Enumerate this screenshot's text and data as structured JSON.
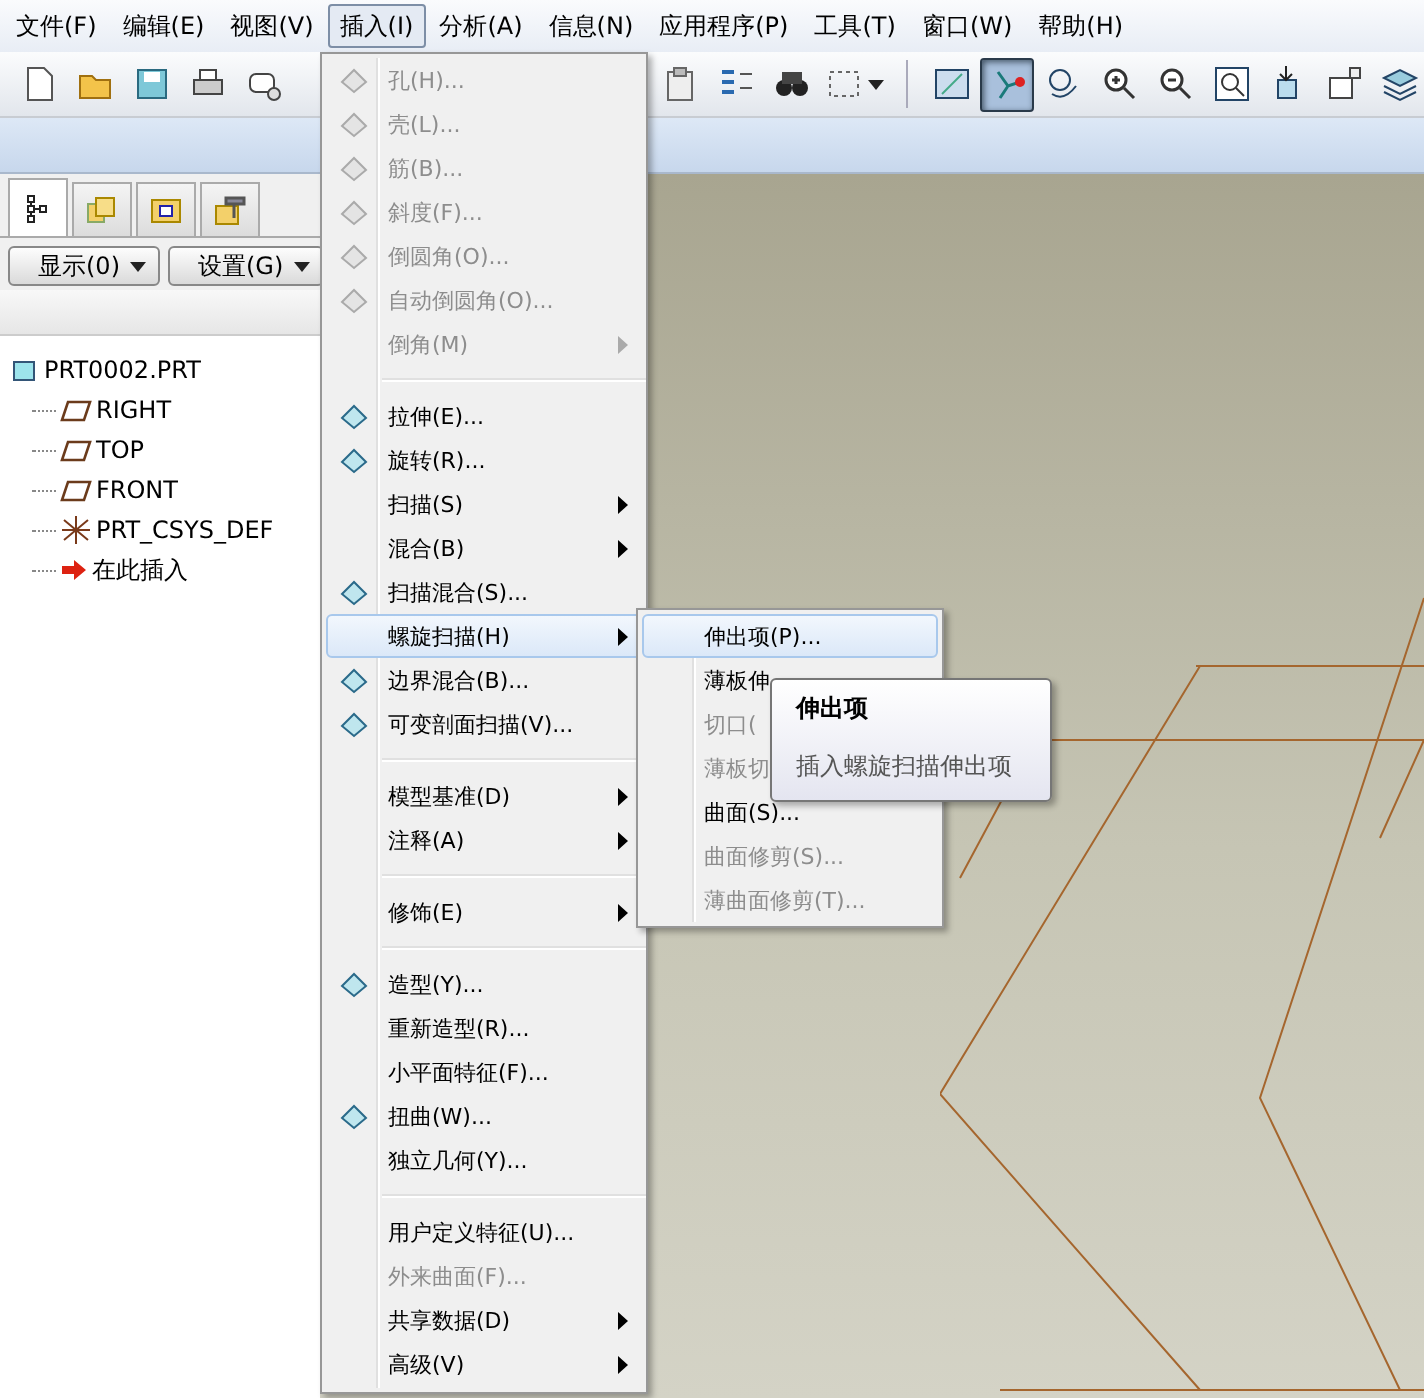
{
  "menubar": [
    {
      "label": "文件(F)",
      "selected": false
    },
    {
      "label": "编辑(E)",
      "selected": false
    },
    {
      "label": "视图(V)",
      "selected": false
    },
    {
      "label": "插入(I)",
      "selected": true
    },
    {
      "label": "分析(A)",
      "selected": false
    },
    {
      "label": "信息(N)",
      "selected": false
    },
    {
      "label": "应用程序(P)",
      "selected": false
    },
    {
      "label": "工具(T)",
      "selected": false
    },
    {
      "label": "窗口(W)",
      "selected": false
    },
    {
      "label": "帮助(H)",
      "selected": false
    }
  ],
  "toolbar": [
    {
      "kind": "new",
      "selected": false
    },
    {
      "kind": "open",
      "selected": false
    },
    {
      "kind": "save",
      "selected": false
    },
    {
      "kind": "print",
      "selected": false
    },
    {
      "kind": "mail",
      "selected": false
    },
    {
      "kind": "gap"
    },
    {
      "kind": "paste",
      "selected": false
    },
    {
      "kind": "regen",
      "selected": false
    },
    {
      "kind": "find",
      "selected": false
    },
    {
      "kind": "select",
      "selected": false
    },
    {
      "kind": "separator"
    },
    {
      "kind": "view",
      "selected": false
    },
    {
      "kind": "node",
      "selected": true
    },
    {
      "kind": "spin",
      "selected": false
    },
    {
      "kind": "zoomin",
      "selected": false
    },
    {
      "kind": "zoomout",
      "selected": false
    },
    {
      "kind": "fit",
      "selected": false
    },
    {
      "kind": "orient",
      "selected": false
    },
    {
      "kind": "rename",
      "selected": false
    },
    {
      "kind": "layers",
      "selected": false
    }
  ],
  "model_tree": {
    "tabs": [
      {
        "selected": true
      },
      {
        "selected": false
      },
      {
        "selected": false
      },
      {
        "selected": false
      }
    ],
    "buttons": [
      "显示(0)",
      "设置(G)"
    ],
    "root": {
      "label": "PRT0002.PRT",
      "children": [
        {
          "label": "RIGHT",
          "kind": "plane"
        },
        {
          "label": "TOP",
          "kind": "plane"
        },
        {
          "label": "FRONT",
          "kind": "plane"
        },
        {
          "label": "PRT_CSYS_DEF",
          "kind": "csys"
        },
        {
          "label": "在此插入",
          "kind": "insert"
        }
      ]
    }
  },
  "insert_menu": [
    {
      "kind": "item",
      "label": "孔(H)...",
      "disabled": true,
      "submenu": false,
      "selected": false
    },
    {
      "kind": "item",
      "label": "壳(L)...",
      "disabled": true,
      "submenu": false,
      "selected": false
    },
    {
      "kind": "item",
      "label": "筋(B)...",
      "disabled": true,
      "submenu": false,
      "selected": false
    },
    {
      "kind": "item",
      "label": "斜度(F)...",
      "disabled": true,
      "submenu": false,
      "selected": false
    },
    {
      "kind": "item",
      "label": "倒圆角(O)...",
      "disabled": true,
      "submenu": false,
      "selected": false
    },
    {
      "kind": "item",
      "label": "自动倒圆角(O)...",
      "disabled": true,
      "submenu": false,
      "selected": false
    },
    {
      "kind": "item",
      "label": "倒角(M)",
      "disabled": true,
      "submenu": true,
      "selected": false
    },
    {
      "kind": "separator"
    },
    {
      "kind": "item",
      "label": "拉伸(E)...",
      "disabled": false,
      "submenu": false,
      "selected": false
    },
    {
      "kind": "item",
      "label": "旋转(R)...",
      "disabled": false,
      "submenu": false,
      "selected": false
    },
    {
      "kind": "item",
      "label": "扫描(S)",
      "disabled": false,
      "submenu": true,
      "selected": false
    },
    {
      "kind": "item",
      "label": "混合(B)",
      "disabled": false,
      "submenu": true,
      "selected": false
    },
    {
      "kind": "item",
      "label": "扫描混合(S)...",
      "disabled": false,
      "submenu": false,
      "selected": false
    },
    {
      "kind": "item",
      "label": "螺旋扫描(H)",
      "disabled": false,
      "submenu": true,
      "selected": true
    },
    {
      "kind": "item",
      "label": "边界混合(B)...",
      "disabled": false,
      "submenu": false,
      "selected": false
    },
    {
      "kind": "item",
      "label": "可变剖面扫描(V)...",
      "disabled": false,
      "submenu": false,
      "selected": false
    },
    {
      "kind": "separator"
    },
    {
      "kind": "item",
      "label": "模型基准(D)",
      "disabled": false,
      "submenu": true,
      "selected": false
    },
    {
      "kind": "item",
      "label": "注释(A)",
      "disabled": false,
      "submenu": true,
      "selected": false
    },
    {
      "kind": "separator"
    },
    {
      "kind": "item",
      "label": "修饰(E)",
      "disabled": false,
      "submenu": true,
      "selected": false
    },
    {
      "kind": "separator"
    },
    {
      "kind": "item",
      "label": "造型(Y)...",
      "disabled": false,
      "submenu": false,
      "selected": false
    },
    {
      "kind": "item",
      "label": "重新造型(R)...",
      "disabled": false,
      "submenu": false,
      "selected": false
    },
    {
      "kind": "item",
      "label": "小平面特征(F)...",
      "disabled": false,
      "submenu": false,
      "selected": false
    },
    {
      "kind": "item",
      "label": "扭曲(W)...",
      "disabled": false,
      "submenu": false,
      "selected": false
    },
    {
      "kind": "item",
      "label": "独立几何(Y)...",
      "disabled": false,
      "submenu": false,
      "selected": false
    },
    {
      "kind": "separator"
    },
    {
      "kind": "item",
      "label": "用户定义特征(U)...",
      "disabled": false,
      "submenu": false,
      "selected": false
    },
    {
      "kind": "item",
      "label": "外来曲面(F)...",
      "disabled": true,
      "submenu": false,
      "selected": false
    },
    {
      "kind": "item",
      "label": "共享数据(D)",
      "disabled": false,
      "submenu": true,
      "selected": false
    },
    {
      "kind": "item",
      "label": "高级(V)",
      "disabled": false,
      "submenu": true,
      "selected": false
    }
  ],
  "helical_sweep_submenu": [
    {
      "label": "伸出项(P)...",
      "disabled": false,
      "selected": true
    },
    {
      "label": "薄板伸",
      "disabled": false,
      "selected": false
    },
    {
      "label": "切口(",
      "disabled": true,
      "selected": false
    },
    {
      "label": "薄板切",
      "disabled": true,
      "selected": false
    },
    {
      "label": "曲面(S)...",
      "disabled": false,
      "selected": false
    },
    {
      "label": "曲面修剪(S)...",
      "disabled": true,
      "selected": false
    },
    {
      "label": "薄曲面修剪(T)...",
      "disabled": true,
      "selected": false
    }
  ],
  "tooltip": {
    "title": "伸出项",
    "description": "插入螺旋扫描伸出项"
  }
}
